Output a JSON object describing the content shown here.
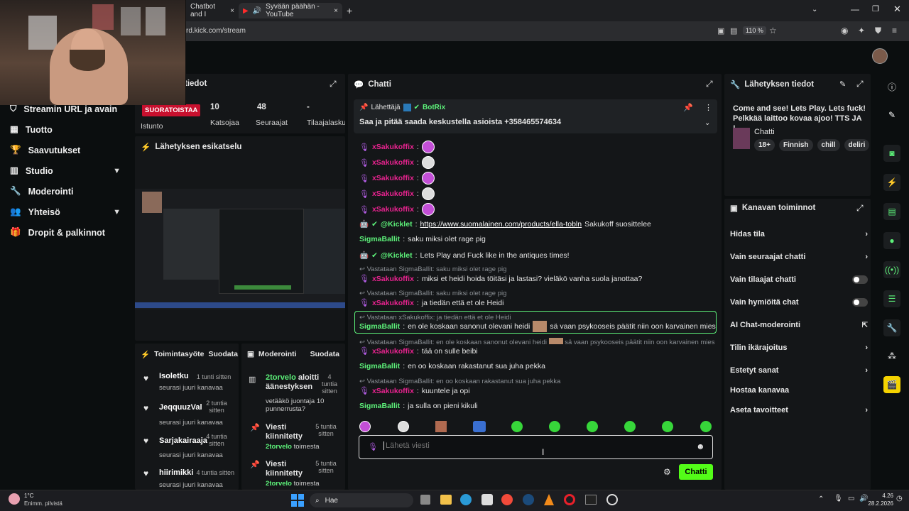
{
  "browser": {
    "tabs": [
      {
        "label": "Chatbot and I"
      },
      {
        "label": "Syvään päähän - YouTube"
      }
    ],
    "address": "rd.kick.com/stream",
    "zoom": "110 %"
  },
  "sidebar": {
    "items": [
      {
        "label": "Streamin URL ja avain",
        "icon": "shield-icon"
      },
      {
        "label": "Tuotto",
        "icon": "chart-icon"
      },
      {
        "label": "Saavutukset",
        "icon": "trophy-icon"
      },
      {
        "label": "Studio",
        "icon": "grid-icon"
      },
      {
        "label": "Moderointi",
        "icon": "sword-icon"
      },
      {
        "label": "Yhteisö",
        "icon": "people-icon"
      },
      {
        "label": "Dropit & palkinnot",
        "icon": "gift-icon"
      }
    ]
  },
  "session": {
    "title": "tiedot",
    "live_badge": "SUORATOISTAA",
    "live_label": "Istunto",
    "viewers_value": "10",
    "viewers_label": "Katsojaa",
    "followers_value": "48",
    "followers_label": "Seuraajat",
    "subs_value": "-",
    "subs_label": "Tilaajalasku"
  },
  "preview": {
    "title": "Lähetyksen esikatselu"
  },
  "activity": {
    "title": "Toimintasyöte",
    "follow": "Suodata",
    "items": [
      {
        "name": "Isoletku",
        "time": "1 tunti sitten",
        "desc": "seurasi juuri kanavaa"
      },
      {
        "name": "JeqquuzVal",
        "time": "2 tuntia sitten",
        "desc": "seurasi juuri kanavaa"
      },
      {
        "name": "Sarjakairaaja",
        "time": "4 tuntia sitten",
        "desc": "seurasi juuri kanavaa"
      },
      {
        "name": "hiirimikki",
        "time": "4 tuntia sitten",
        "desc": "seurasi juuri kanavaa"
      }
    ]
  },
  "moderation": {
    "title": "Moderointi",
    "filter": "Suodata",
    "items": [
      {
        "user": "2torvelo",
        "action": "aloitti äänestyksen",
        "time": "4 tuntia sitten",
        "desc": "vetääkö juontaja 10 punnerrusta?"
      },
      {
        "action": "Viesti kiinnitetty",
        "time": "5 tuntia sitten",
        "by": "2torvelo",
        "suffix": "toimesta"
      },
      {
        "action": "Viesti kiinnitetty",
        "time": "5 tuntia sitten",
        "by": "2torvelo",
        "suffix": "toimesta"
      }
    ]
  },
  "chat": {
    "title": "Chatti",
    "pinned": {
      "label": "Lähettäjä",
      "bot": "BotRix",
      "text": "Saa ja pitää saada keskustella asioista +358465574634"
    },
    "messages": [
      {
        "user": "xSakukoffix",
        "text": ""
      },
      {
        "user": "xSakukoffix",
        "text": ""
      },
      {
        "user": "xSakukoffix",
        "text": ""
      },
      {
        "user": "xSakukoffix",
        "text": ""
      },
      {
        "user": "xSakukoffix",
        "text": ""
      },
      {
        "user": "@Kicklet",
        "link": "https://www.suomalainen.com/products/ella-tobln",
        "text": "Sakukoff suosittelee"
      },
      {
        "user": "SigmaBallit",
        "text": "saku miksi olet rage pig"
      },
      {
        "user": "@Kicklet",
        "text": "Lets Play and Fuck like in the antiques times!"
      },
      {
        "reply": "Vastataan SigmaBallit: saku miksi olet rage pig",
        "user": "xSakukoffix",
        "text": "miksi et heidi hoida töitäsi ja lastasi? vieläkö vanha suola janottaa?"
      },
      {
        "reply": "Vastataan SigmaBallit: saku miksi olet rage pig",
        "user": "xSakukoffix",
        "text": "ja tiedän että et ole Heidi"
      },
      {
        "reply": "Vastataan xSakukoffix: ja tiedän että et ole Heidi",
        "user": "SigmaBallit",
        "text": "en ole koskaan sanonut olevani heidi",
        "text2": "sä vaan psykooseis päätit niin oon karvainen mies"
      },
      {
        "reply": "Vastataan SigmaBallit: en ole koskaan sanonut olevani heidi",
        "reply2": "sä vaan psykooseis päätit niin oon karvainen mies",
        "user": "xSakukoffix",
        "text": "tää on sulle beibi"
      },
      {
        "user": "SigmaBallit",
        "text": "en oo koskaan rakastanut sua juha pekka"
      },
      {
        "reply": "Vastataan SigmaBallit: en oo koskaan rakastanut sua juha pekka",
        "user": "xSakukoffix",
        "text": "kuuntele ja opi"
      },
      {
        "user": "SigmaBallit",
        "text": "ja sulla on pieni kikuli"
      }
    ],
    "input_placeholder": "Lähetä viesti",
    "send_label": "Chatti"
  },
  "stream_info": {
    "title": "Lähetyksen tiedot",
    "stream_title": "Come and see! Lets Play. Lets fuck! Pelkkää laittoo kovaa ajoo! TTS JA !...",
    "category": "Chatti",
    "tags": [
      "18+",
      "Finnish",
      "chill",
      "deliri"
    ]
  },
  "channel_actions": {
    "title": "Kanavan toiminnot",
    "items": [
      {
        "label": "Hidas tila",
        "control": "chevron"
      },
      {
        "label": "Vain seuraajat chatti",
        "control": "chevron"
      },
      {
        "label": "Vain tilaajat chatti",
        "control": "toggle"
      },
      {
        "label": "Vain hymiöitä chat",
        "control": "toggle"
      },
      {
        "label": "AI Chat-moderointi",
        "control": "external"
      },
      {
        "label": "Tilin ikärajoitus",
        "control": "chevron"
      },
      {
        "label": "Estetyt sanat",
        "control": "chevron"
      },
      {
        "label": "Hostaa kanavaa",
        "control": "none"
      },
      {
        "label": "Aseta tavoitteet",
        "control": "chevron"
      }
    ]
  },
  "taskbar": {
    "weather_temp": "1°C",
    "weather_desc": "Enimm. pilvistä",
    "search": "Hae",
    "time": "4.26",
    "date": "28.2.2026"
  },
  "colors": {
    "accent": "#53fc18",
    "live": "#c8102e",
    "pink": "#e8238f"
  }
}
